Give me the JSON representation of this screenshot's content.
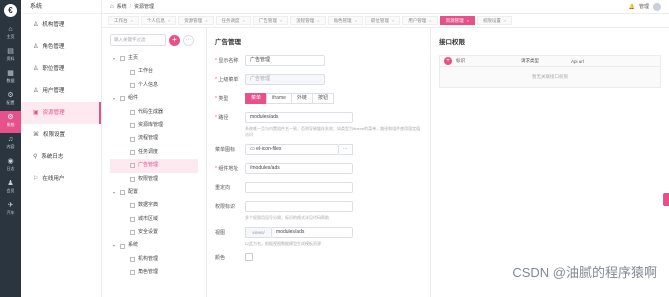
{
  "rail": {
    "logo": "€",
    "items": [
      {
        "glyph": "⌂",
        "label": "主页",
        "active": false
      },
      {
        "glyph": "▤",
        "label": "资料",
        "active": false
      },
      {
        "glyph": "▦",
        "label": "数据",
        "active": false
      },
      {
        "glyph": "⚙",
        "label": "配置",
        "active": false
      },
      {
        "glyph": "⚙",
        "label": "系统",
        "active": true
      },
      {
        "glyph": "♫",
        "label": "内容",
        "active": false
      },
      {
        "glyph": "◉",
        "label": "日志",
        "active": false
      },
      {
        "glyph": "♟",
        "label": "会员",
        "active": false
      },
      {
        "glyph": "✈",
        "label": "汽车",
        "active": false
      }
    ]
  },
  "menu": {
    "title": "系统",
    "items": [
      {
        "glyph": "♙",
        "label": "机构管理",
        "active": false
      },
      {
        "glyph": "♙",
        "label": "角色管理",
        "active": false
      },
      {
        "glyph": "♙",
        "label": "职位管理",
        "active": false
      },
      {
        "glyph": "♙",
        "label": "用户管理",
        "active": false
      },
      {
        "glyph": "▣",
        "label": "资源管理",
        "active": true
      },
      {
        "glyph": "⌘",
        "label": "权限设置",
        "active": false
      },
      {
        "glyph": "⚲",
        "label": "系统日志",
        "active": false
      },
      {
        "glyph": "⚐",
        "label": "在线用户",
        "active": false
      }
    ]
  },
  "breadcrumb": {
    "home": "系统",
    "sep": "/",
    "current": "资源管理"
  },
  "header": {
    "bell": "🔔",
    "user": "管理"
  },
  "tabs": [
    {
      "label": "工作台",
      "active": false
    },
    {
      "label": "个人信息",
      "active": false
    },
    {
      "label": "资源管理",
      "active": false
    },
    {
      "label": "任务调度",
      "active": false
    },
    {
      "label": "广告管理",
      "active": false
    },
    {
      "label": "流程管理",
      "active": false
    },
    {
      "label": "角色管理",
      "active": false
    },
    {
      "label": "职位管理",
      "active": false
    },
    {
      "label": "用户管理",
      "active": false
    },
    {
      "label": "资源管理",
      "active": true
    },
    {
      "label": "权限设置",
      "active": false
    }
  ],
  "tree": {
    "search_placeholder": "输入关键字过滤",
    "add": "+",
    "more": "⋯",
    "nodes": [
      {
        "label": "主页",
        "level": 1,
        "arrow": "▾",
        "selected": false
      },
      {
        "label": "工作台",
        "level": 2,
        "arrow": "",
        "selected": false
      },
      {
        "label": "个人信息",
        "level": 2,
        "arrow": "",
        "selected": false
      },
      {
        "label": "组件",
        "level": 1,
        "arrow": "▾",
        "selected": false
      },
      {
        "label": "代码生成器",
        "level": 2,
        "arrow": "",
        "selected": false
      },
      {
        "label": "资源库管理",
        "level": 2,
        "arrow": "",
        "selected": false
      },
      {
        "label": "流程管理",
        "level": 2,
        "arrow": "",
        "selected": false
      },
      {
        "label": "任务调度",
        "level": 2,
        "arrow": "",
        "selected": false
      },
      {
        "label": "广告管理",
        "level": 2,
        "arrow": "",
        "selected": true
      },
      {
        "label": "权限管理",
        "level": 2,
        "arrow": "",
        "selected": false
      },
      {
        "label": "配置",
        "level": 1,
        "arrow": "▾",
        "selected": false
      },
      {
        "label": "数据字典",
        "level": 2,
        "arrow": "",
        "selected": false
      },
      {
        "label": "城市区域",
        "level": 2,
        "arrow": "",
        "selected": false
      },
      {
        "label": "安全设置",
        "level": 2,
        "arrow": "",
        "selected": false
      },
      {
        "label": "系统",
        "level": 1,
        "arrow": "▾",
        "selected": false
      },
      {
        "label": "机构管理",
        "level": 2,
        "arrow": "",
        "selected": false
      },
      {
        "label": "角色管理",
        "level": 2,
        "arrow": "",
        "selected": false
      }
    ]
  },
  "form": {
    "title": "广告管理",
    "display_name": {
      "label": "显示名称",
      "value": "广告管理"
    },
    "parent": {
      "label": "上级菜单",
      "value": "广告管理"
    },
    "type": {
      "label": "类型",
      "options": [
        "菜单",
        "iframe",
        "外链",
        "按钮"
      ],
      "selected": 0
    },
    "route": {
      "label": "路径",
      "value": "modules/ads",
      "hint": "系统唯一且与内置组件名一致，否则导致缓存失效；如类型为iframe的菜单，路径和组件使用固定值访问"
    },
    "icon": {
      "label": "菜单图标",
      "value": "el-icon-files",
      "btn": "⋯"
    },
    "component": {
      "label": "组件地址",
      "value": "/modules/ads"
    },
    "redirect": {
      "label": "重定向",
      "value": ""
    },
    "perms": {
      "label": "权限标识",
      "value": "",
      "hint": "多个权限用逗号分隔，标识的格式详见代码帮助"
    },
    "view": {
      "label": "视图",
      "prefix": "views/",
      "value": "modules/ads",
      "hint": "以此为名，根据视图数据模型生成模板资源"
    },
    "color": {
      "label": "颜色"
    }
  },
  "perm": {
    "title": "接口权限",
    "add": "+",
    "col_name": "标识",
    "col_method": "请求类型",
    "col_url": "Api url",
    "empty": "暂无关联接口权限"
  },
  "watermark": "CSDN @油腻的程序猿啊"
}
